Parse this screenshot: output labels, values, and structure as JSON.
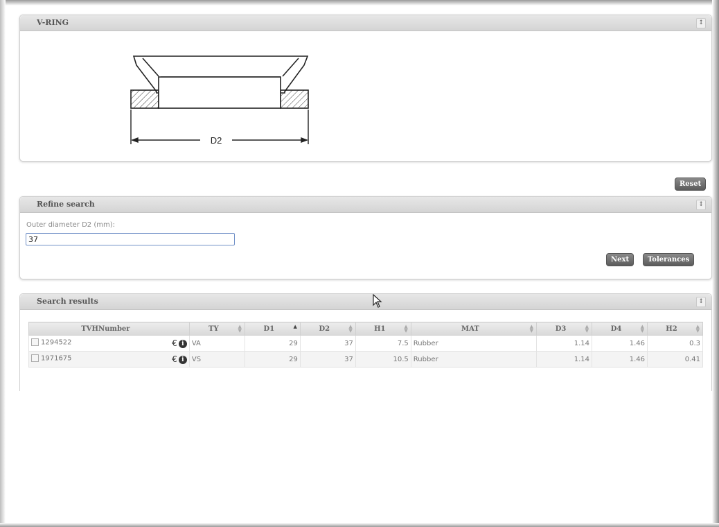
{
  "vring_panel": {
    "title": "V-RING",
    "collapse": "↕",
    "dimension_label": "D2"
  },
  "actions": {
    "reset_label": "Reset"
  },
  "refine_panel": {
    "title": "Refine search",
    "collapse": "↕",
    "field_label": "Outer diameter D2 (mm):",
    "field_value": "37",
    "next_label": "Next",
    "tolerances_label": "Tolerances"
  },
  "results_panel": {
    "title": "Search results",
    "collapse": "↕",
    "columns": [
      "TVHNumber",
      "TY",
      "D1",
      "D2",
      "H1",
      "MAT",
      "D3",
      "D4",
      "H2"
    ],
    "rows": [
      {
        "tvh": "1294522",
        "ty": "VA",
        "d1": "29",
        "d2": "37",
        "h1": "7.5",
        "mat": "Rubber",
        "d3": "1.14",
        "d4": "1.46",
        "h2": "0.3"
      },
      {
        "tvh": "1971675",
        "ty": "VS",
        "d1": "29",
        "d2": "37",
        "h1": "10.5",
        "mat": "Rubber",
        "d3": "1.14",
        "d4": "1.46",
        "h2": "0.41"
      }
    ],
    "icons": [
      "euro-icon",
      "info-icon"
    ]
  }
}
